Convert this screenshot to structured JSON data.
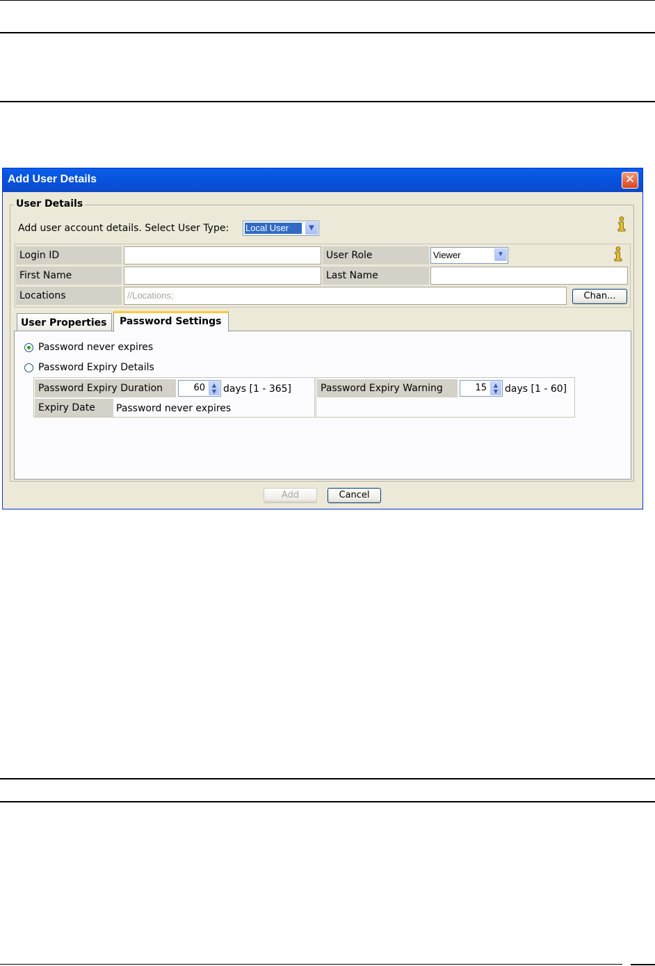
{
  "dialog": {
    "title": "Add User Details",
    "close_glyph": "✕",
    "group_title": "User Details",
    "intro_text": "Add user account details. Select User Type:",
    "user_type": {
      "selected": "Local User"
    },
    "fields": {
      "login_id_label": "Login ID",
      "login_id_value": "",
      "user_role_label": "User Role",
      "user_role_selected": "Viewer",
      "first_name_label": "First Name",
      "first_name_value": "",
      "last_name_label": "Last Name",
      "last_name_value": "",
      "locations_label": "Locations",
      "locations_placeholder": "//Locations;",
      "change_button": "Chan..."
    },
    "tabs": [
      {
        "label": "User Properties",
        "active": false
      },
      {
        "label": "Password Settings",
        "active": true
      }
    ],
    "password": {
      "option_never": "Password never expires",
      "option_details": "Password Expiry Details",
      "selected_option": "never",
      "duration_label": "Password Expiry Duration",
      "duration_value": "60",
      "duration_range": "days [1 - 365]",
      "warning_label": "Password Expiry Warning",
      "warning_value": "15",
      "warning_range": "days [1 - 60]",
      "expiry_date_label": "Expiry Date",
      "expiry_date_value": "Password never expires"
    },
    "buttons": {
      "add": "Add",
      "cancel": "Cancel"
    },
    "icons": {
      "info": "info-icon",
      "close": "close-icon",
      "dropdown": "chevron-down-icon"
    },
    "colors": {
      "titlebar": "#0654e0",
      "dialog_bg": "#ece9d8",
      "selection": "#316ac5",
      "active_tab_accent": "#ffc83c"
    }
  }
}
